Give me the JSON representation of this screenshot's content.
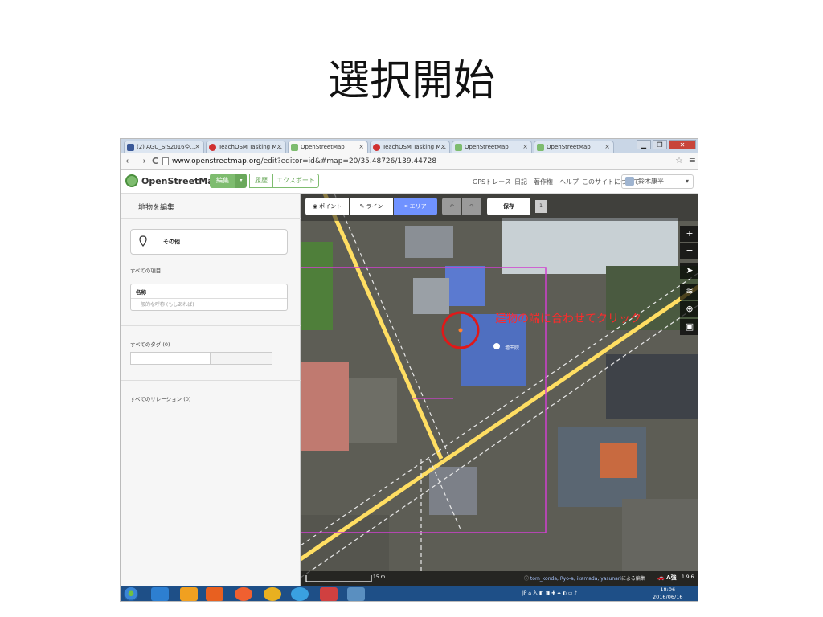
{
  "slide": {
    "title": "選択開始"
  },
  "browser": {
    "tabs": [
      {
        "label": "(2) AGU_SIS2016空...",
        "color": "#3b5998",
        "active": false
      },
      {
        "label": "TeachOSM Tasking M...",
        "color": "#d03030",
        "active": false
      },
      {
        "label": "OpenStreetMap",
        "color": "#7ebc6f",
        "active": true
      },
      {
        "label": "TeachOSM Tasking M...",
        "color": "#d03030",
        "active": false
      },
      {
        "label": "OpenStreetMap",
        "color": "#7ebc6f",
        "active": false
      },
      {
        "label": "OpenStreetMap",
        "color": "#7ebc6f",
        "active": false
      }
    ],
    "tab_close": "×",
    "window_controls": [
      "▁",
      "❐",
      "✕"
    ],
    "back": "←",
    "forward": "→",
    "reload": "C",
    "url_host": "www.openstreetmap.org",
    "url_path": "/edit?editor=id&#map=20/35.48726/139.44728",
    "star": "☆",
    "menu": "≡"
  },
  "osm_header": {
    "name": "OpenStreetMap",
    "edit": "編集",
    "edit_dropdown": "▾",
    "history": "履歴",
    "export": "エクスポート",
    "links": [
      "GPSトレース",
      "日記",
      "著作権",
      "ヘルプ",
      "このサイトについて"
    ],
    "user": "鈴木康平",
    "user_dropdown": "▾"
  },
  "sidebar": {
    "title": "地物を編集",
    "preset": "その他",
    "all_fields": "すべての項目",
    "field_name": "名称",
    "field_placeholder": "一般的な呼称 (もしあれば)",
    "all_tags": "すべてのタグ (0)",
    "all_relations": "すべてのリレーション (0)"
  },
  "map": {
    "toolbar": {
      "point": "ポイント",
      "line": "ライン",
      "area": "エリア",
      "undo": "↶",
      "redo": "↷",
      "save": "保存",
      "count": "1"
    },
    "controls": [
      "+",
      "−",
      "➤",
      "≋",
      "⊕",
      "▣"
    ],
    "instruction": "建物の端に合わせてクリック",
    "poi_label": "増田院",
    "scale": "15 m",
    "attrib_users": "tom_konda, Ryo-a, ikamada, yasunari",
    "attrib_suffix": "による編集",
    "bing": "🚗 A強",
    "version": "1.9.6"
  },
  "taskbar": {
    "apps": [
      "#2d7fd1",
      "#f0a020",
      "#e86020",
      "#f06030",
      "#e8b020",
      "#3aa0e0",
      "#d04040",
      "#5a8fc0"
    ],
    "tray": "JP ⌂ 入 ◧ ◨ ✚ ⏶ ◐ ▭ ♪",
    "time": "18:06",
    "date": "2016/06/16"
  },
  "colors": {
    "osm_green": "#7ebc6f",
    "active_mode": "#7092ff",
    "instruction_red": "#ff2a2a",
    "area_outline": "#d040d0",
    "road_yellow": "#ffde62",
    "taskbar": "#1e4f87"
  }
}
